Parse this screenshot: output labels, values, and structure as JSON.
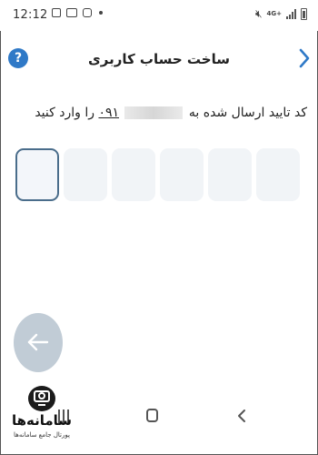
{
  "status_bar": {
    "time": "12:12",
    "network": "4G+"
  },
  "header": {
    "title": "ساخت حساب کاربری",
    "help_label": "?"
  },
  "prompt": {
    "before": "کد تایید ارسال شده به",
    "number_prefix": "۰۹۱",
    "after": "را وارد کنید"
  },
  "code_input": {
    "boxes": [
      "",
      "",
      "",
      "",
      "",
      ""
    ]
  },
  "watermark": {
    "brand": "سامانه‌ها",
    "tagline": "پورتال جامع سامانه‌ها"
  }
}
